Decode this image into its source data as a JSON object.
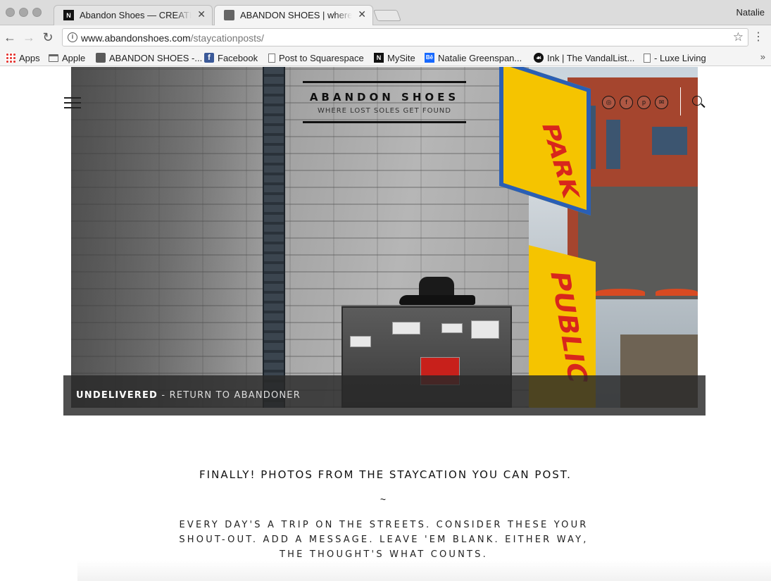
{
  "browser": {
    "tabs": [
      {
        "title": "Abandon Shoes — CREATIVE A",
        "favicon": "N",
        "active": false
      },
      {
        "title": "ABANDON SHOES | where lost",
        "favicon": "cube",
        "active": true
      }
    ],
    "profile_name": "Natalie",
    "url_domain": "www.abandonshoes.com",
    "url_path": "/staycationposts/",
    "bookmarks": [
      {
        "label": "Apps",
        "icon": "apps-grid-icon"
      },
      {
        "label": "Apple",
        "icon": "folder-icon"
      },
      {
        "label": "ABANDON SHOES -...",
        "icon": "cube-icon"
      },
      {
        "label": "Facebook",
        "icon": "facebook-icon"
      },
      {
        "label": "Post to Squarespace",
        "icon": "page-icon"
      },
      {
        "label": "MySite",
        "icon": "n-icon"
      },
      {
        "label": "Natalie Greenspan...",
        "icon": "behance-icon"
      },
      {
        "label": "Ink | The VandalList...",
        "icon": "ink-icon"
      },
      {
        "label": "- Luxe Living",
        "icon": "page-icon"
      }
    ]
  },
  "site": {
    "brand": "ABANDON SHOES",
    "tagline": "WHERE LOST SOLES GET FOUND",
    "social_icons": [
      "instagram-icon",
      "facebook-icon",
      "pinterest-icon",
      "email-icon"
    ]
  },
  "hero": {
    "caption_bold": "UNDELIVERED",
    "caption_rest": " - RETURN TO ABANDONER"
  },
  "content": {
    "headline": "FINALLY! PHOTOS FROM THE STAYCATION YOU CAN POST.",
    "separator": "~",
    "body": "EVERY DAY'S A TRIP ON THE STREETS. CONSIDER THESE YOUR SHOUT-OUT. ADD A MESSAGE. LEAVE 'EM BLANK. EITHER WAY, THE THOUGHT'S WHAT COUNTS."
  }
}
